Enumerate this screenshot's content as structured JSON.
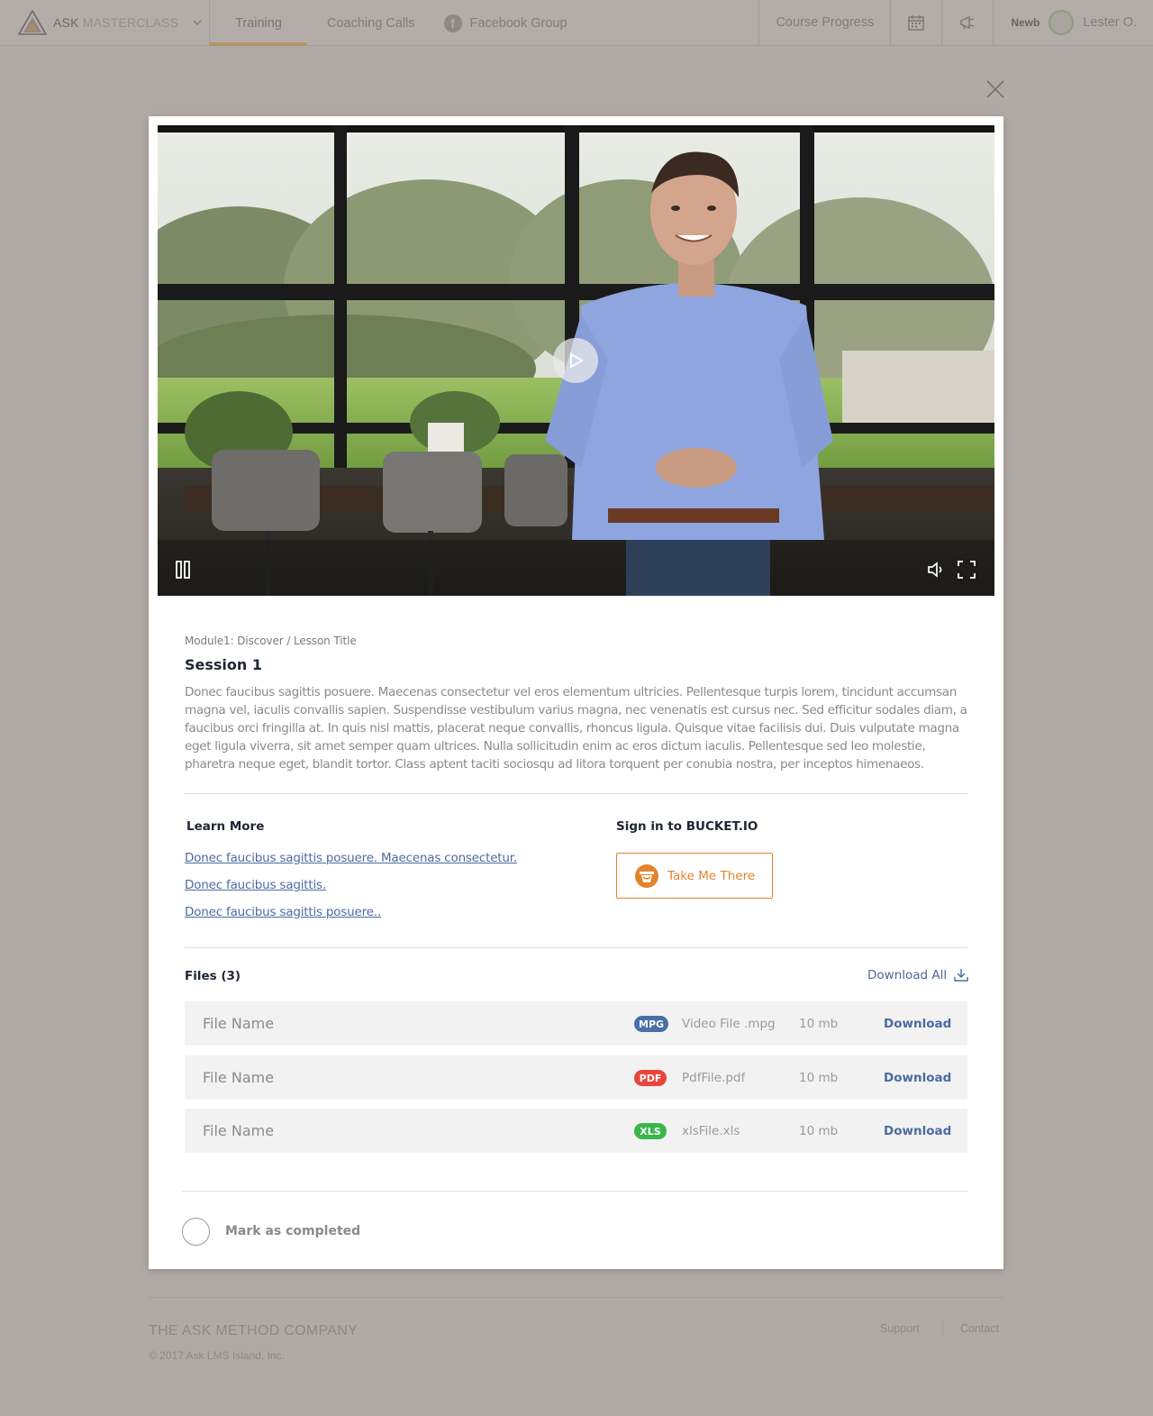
{
  "nav": {
    "brand_strong": "ASK",
    "brand_light": "MASTERCLASS",
    "tabs": [
      {
        "label": "Training",
        "active": true
      },
      {
        "label": "Coaching Calls"
      },
      {
        "label": "Facebook Group",
        "icon": "facebook-icon"
      }
    ],
    "course_progress": "Course Progress",
    "icons": [
      "calendar-icon",
      "megaphone-icon"
    ],
    "user_badge": "Newb",
    "user_name": "Lester O."
  },
  "lesson": {
    "breadcrumb": "Module1: Discover / Lesson Title",
    "title": "Session 1",
    "description": "Donec faucibus sagittis posuere. Maecenas consectetur vel eros elementum ultricies. Pellentesque turpis lorem, tincidunt accumsan magna vel, iaculis convallis sapien. Suspendisse vestibulum varius magna, nec venenatis est cursus nec. Sed efficitur sodales diam, a faucibus orci fringilla at. In quis nisl mattis, placerat neque convallis, rhoncus ligula. Quisque vitae facilisis dui. Duis vulputate magna eget ligula viverra, sit amet semper quam ultrices. Nulla sollicitudin enim ac eros dictum iaculis. Pellentesque sed leo molestie, pharetra neque eget, blandit tortor. Class aptent taciti sociosqu ad litora torquent per conubia nostra, per inceptos himenaeos."
  },
  "learn_more": {
    "title": "Learn More",
    "links": [
      "Donec faucibus sagittis posuere. Maecenas consectetur.",
      "Donec faucibus sagittis.",
      "Donec faucibus sagittis posuere.."
    ]
  },
  "bucket": {
    "title": "Sign in to BUCKET.IO",
    "button_label": "Take Me There"
  },
  "files": {
    "title": "Files (3)",
    "download_all": "Download All",
    "items": [
      {
        "name": "File Name",
        "type": "MPG",
        "type_color": "#4a6fa5",
        "desc": "Video File .mpg",
        "size": "10 mb",
        "action": "Download"
      },
      {
        "name": "File Name",
        "type": "PDF",
        "type_color": "#e8453c",
        "desc": "PdfFile.pdf",
        "size": "10 mb",
        "action": "Download"
      },
      {
        "name": "File Name",
        "type": "XLS",
        "type_color": "#3cb64a",
        "desc": "xlsFile.xls",
        "size": "10 mb",
        "action": "Download"
      }
    ]
  },
  "completion": {
    "label": "Mark as completed"
  },
  "footer": {
    "company": "THE ASK METHOD COMPANY",
    "copyright": "© 2017 Ask LMS Island, Inc.",
    "links": [
      "Support",
      "Contact"
    ]
  },
  "colors": {
    "accent": "#b39566",
    "link": "#4d6aa0",
    "bucket_orange": "#e2832d"
  }
}
